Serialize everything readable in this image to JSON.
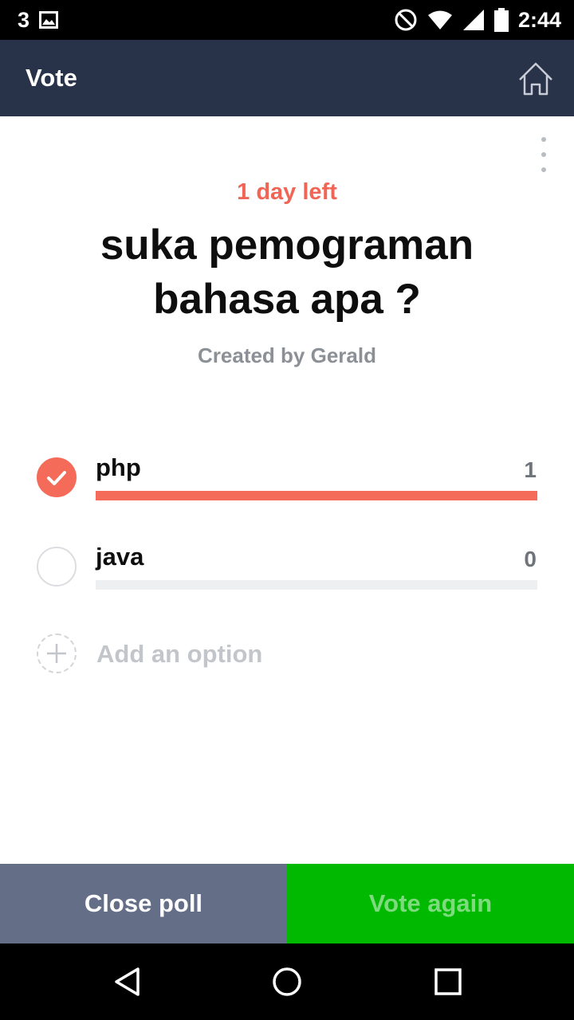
{
  "status_bar": {
    "notification_count": "3",
    "time": "2:44",
    "icons": [
      "image-icon",
      "do-not-disturb-icon",
      "wifi-icon",
      "signal-icon",
      "battery-icon"
    ]
  },
  "app_bar": {
    "title": "Vote",
    "home_icon": "home-icon"
  },
  "poll": {
    "time_left": "1 day left",
    "question": "suka pemograman bahasa apa ?",
    "created_by": "Created by Gerald",
    "options": [
      {
        "label": "php",
        "count": "1",
        "selected": true,
        "share": 1.0
      },
      {
        "label": "java",
        "count": "0",
        "selected": false,
        "share": 0.0
      }
    ],
    "add_option_label": "Add an option"
  },
  "actions": {
    "close_label": "Close poll",
    "vote_again_label": "Vote again"
  },
  "colors": {
    "accent": "#f56b5a",
    "app_bar": "#283249",
    "close_button": "#646e87",
    "vote_button": "#00b900"
  },
  "nav_bar": {
    "icons": [
      "back-icon",
      "home-circle-icon",
      "recents-icon"
    ]
  }
}
